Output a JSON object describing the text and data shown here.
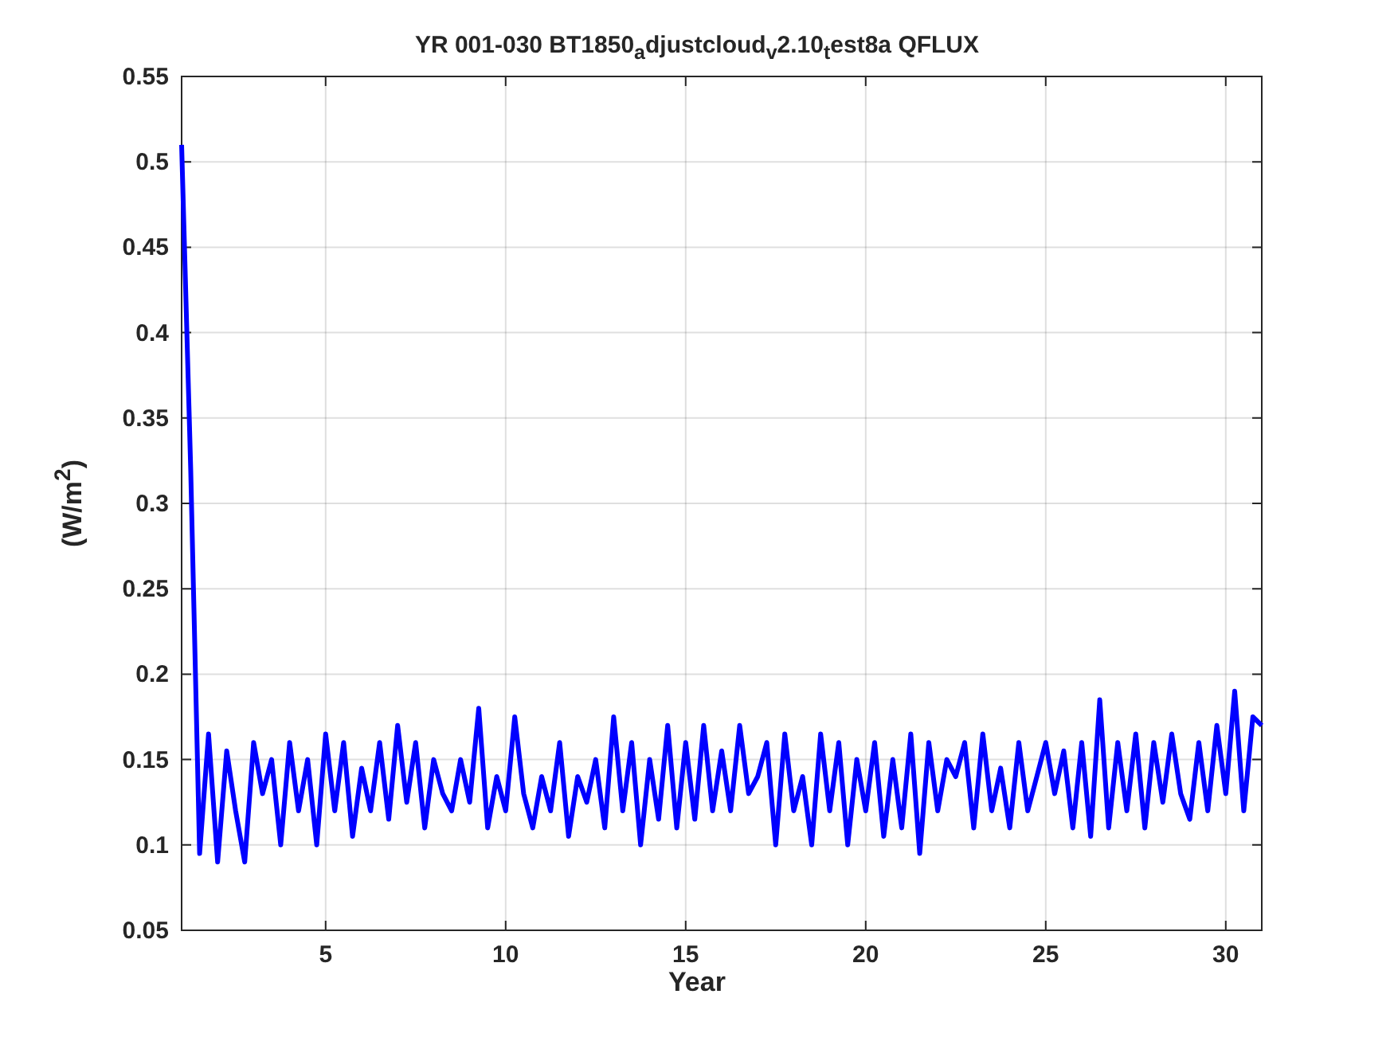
{
  "figure": {
    "chart_data": {
      "type": "line",
      "title": "YR 001-030 BT1850$_{a}$djustcloud$_{v}$2.10$_{t}$est8a QFLUX",
      "xlabel": "Year",
      "ylabel": "(W/m$^{2}$)",
      "xlim": [
        1,
        31
      ],
      "ylim": [
        0.05,
        0.55
      ],
      "xticks": [
        5,
        10,
        15,
        20,
        25,
        30
      ],
      "yticks": [
        {
          "value": 0.05,
          "label": "0.05"
        },
        {
          "value": 0.1,
          "label": "0.1"
        },
        {
          "value": 0.15,
          "label": "0.15"
        },
        {
          "value": 0.2,
          "label": "0.2"
        },
        {
          "value": 0.25,
          "label": "0.25"
        },
        {
          "value": 0.3,
          "label": "0.3"
        },
        {
          "value": 0.35,
          "label": "0.35"
        },
        {
          "value": 0.4,
          "label": "0.4"
        },
        {
          "value": 0.45,
          "label": "0.45"
        },
        {
          "value": 0.5,
          "label": "0.5"
        },
        {
          "value": 0.55,
          "label": "0.55"
        }
      ],
      "x": [
        1,
        1.25,
        1.5,
        1.75,
        2,
        2.25,
        2.5,
        2.75,
        3,
        3.25,
        3.5,
        3.75,
        4,
        4.25,
        4.5,
        4.75,
        5,
        5.25,
        5.5,
        5.75,
        6,
        6.25,
        6.5,
        6.75,
        7,
        7.25,
        7.5,
        7.75,
        8,
        8.25,
        8.5,
        8.75,
        9,
        9.25,
        9.5,
        9.75,
        10,
        10.25,
        10.5,
        10.75,
        11,
        11.25,
        11.5,
        11.75,
        12,
        12.25,
        12.5,
        12.75,
        13,
        13.25,
        13.5,
        13.75,
        14,
        14.25,
        14.5,
        14.75,
        15,
        15.25,
        15.5,
        15.75,
        16,
        16.25,
        16.5,
        16.75,
        17,
        17.25,
        17.5,
        17.75,
        18,
        18.25,
        18.5,
        18.75,
        19,
        19.25,
        19.5,
        19.75,
        20,
        20.25,
        20.5,
        20.75,
        21,
        21.25,
        21.5,
        21.75,
        22,
        22.25,
        22.5,
        22.75,
        23,
        23.25,
        23.5,
        23.75,
        24,
        24.25,
        24.5,
        24.75,
        25,
        25.25,
        25.5,
        25.75,
        26,
        26.25,
        26.5,
        26.75,
        27,
        27.25,
        27.5,
        27.75,
        28,
        28.25,
        28.5,
        28.75,
        29,
        29.25,
        29.5,
        29.75,
        30,
        30.25,
        30.5,
        30.75,
        31
      ],
      "grid": true,
      "series": [
        {
          "color": "#0000ff",
          "values": [
            0.51,
            0.32,
            0.095,
            0.165,
            0.09,
            0.155,
            0.12,
            0.09,
            0.16,
            0.13,
            0.15,
            0.1,
            0.16,
            0.12,
            0.15,
            0.1,
            0.165,
            0.12,
            0.16,
            0.105,
            0.145,
            0.12,
            0.16,
            0.115,
            0.17,
            0.125,
            0.16,
            0.11,
            0.15,
            0.13,
            0.12,
            0.15,
            0.125,
            0.18,
            0.11,
            0.14,
            0.12,
            0.175,
            0.13,
            0.11,
            0.14,
            0.12,
            0.16,
            0.105,
            0.14,
            0.125,
            0.15,
            0.11,
            0.175,
            0.12,
            0.16,
            0.1,
            0.15,
            0.115,
            0.17,
            0.11,
            0.16,
            0.115,
            0.17,
            0.12,
            0.155,
            0.12,
            0.17,
            0.13,
            0.14,
            0.16,
            0.1,
            0.165,
            0.12,
            0.14,
            0.1,
            0.165,
            0.12,
            0.16,
            0.1,
            0.15,
            0.12,
            0.16,
            0.105,
            0.15,
            0.11,
            0.165,
            0.095,
            0.16,
            0.12,
            0.15,
            0.14,
            0.16,
            0.11,
            0.165,
            0.12,
            0.145,
            0.11,
            0.16,
            0.12,
            0.14,
            0.16,
            0.13,
            0.155,
            0.11,
            0.16,
            0.105,
            0.185,
            0.11,
            0.16,
            0.12,
            0.165,
            0.11,
            0.16,
            0.125,
            0.165,
            0.13,
            0.115,
            0.16,
            0.12,
            0.17,
            0.13,
            0.19,
            0.12,
            0.175,
            0.17
          ]
        }
      ]
    }
  }
}
